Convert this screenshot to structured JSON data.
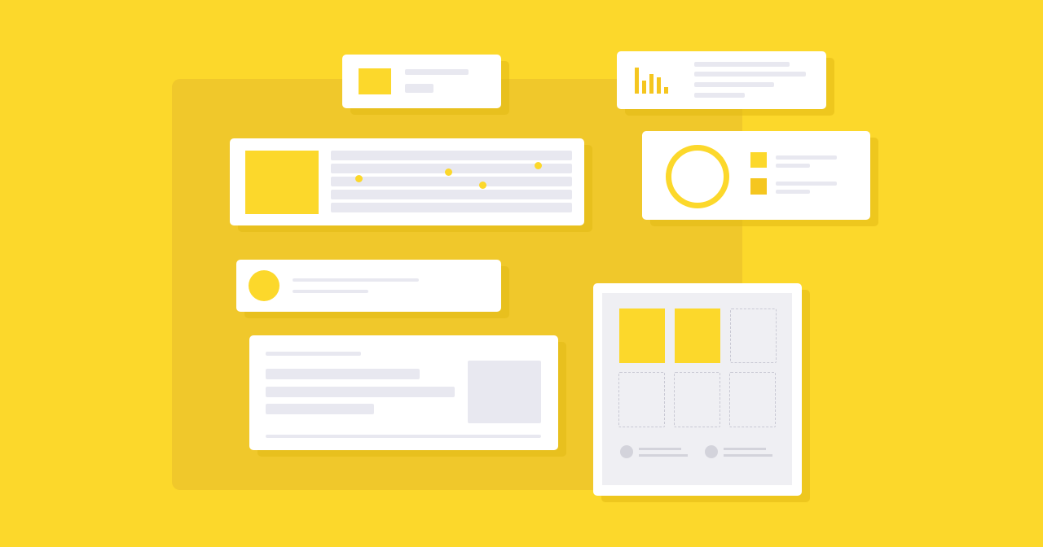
{
  "illustration": {
    "theme": "dashboard-widgets",
    "colors": {
      "background": "#FCD82B",
      "backdrop": "#F0C82B",
      "card": "#FFFFFF",
      "placeholder": "#E8E8F0",
      "accent": "#FCD82B",
      "dashed": "#C9C9D4"
    },
    "icons": [
      "bar-chart-icon",
      "ring-chart-icon",
      "avatar-icon",
      "image-placeholder-icon"
    ],
    "gallery": {
      "filled_slots": 2,
      "empty_slots": 4
    }
  }
}
